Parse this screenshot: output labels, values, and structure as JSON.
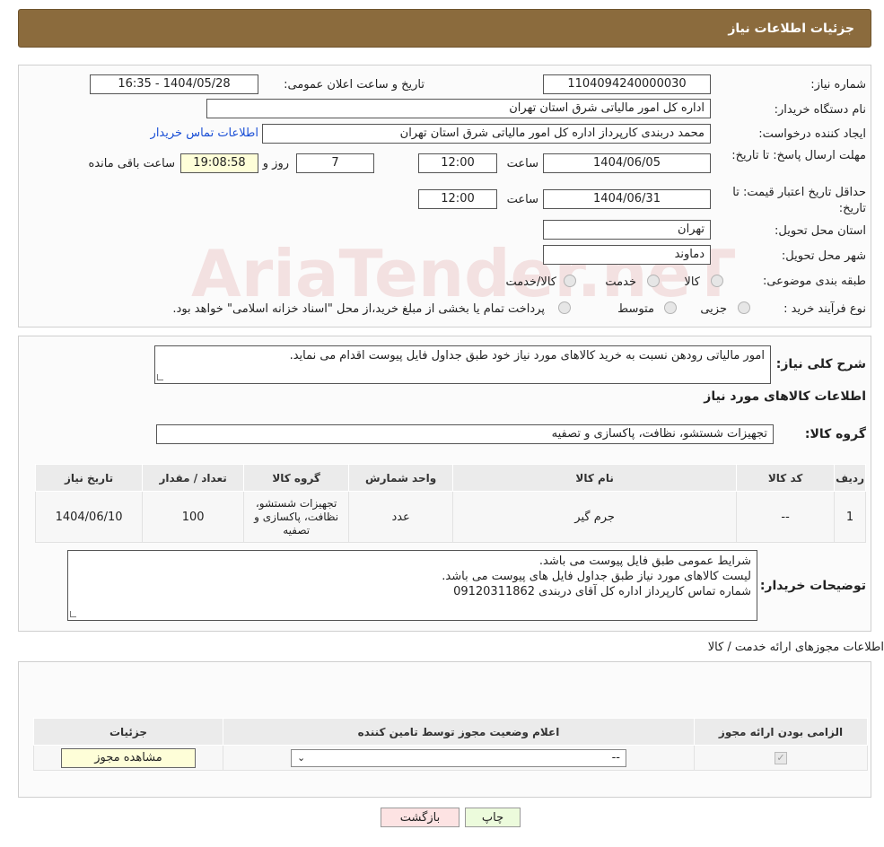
{
  "header": {
    "title": "جزئیات اطلاعات نیاز"
  },
  "watermark": {
    "text": "AriaTender.neT"
  },
  "info": {
    "need_number_label": "شماره نیاز:",
    "need_number": "1104094240000030",
    "announce_label": "تاریخ و ساعت اعلان عمومی:",
    "announce_value": "1404/05/28 - 16:35",
    "buyer_org_label": "نام دستگاه خریدار:",
    "buyer_org": "اداره کل امور مالیاتی شرق استان تهران",
    "creator_label": "ایجاد کننده درخواست:",
    "creator": "محمد دربندی کارپرداز اداره کل امور مالیاتی شرق استان تهران",
    "contact_link": "اطلاعات تماس خریدار",
    "deadline_label": "مهلت ارسال پاسخ: تا تاریخ:",
    "deadline_date": "1404/06/05",
    "time_label": "ساعت",
    "deadline_time": "12:00",
    "days_value": "7",
    "days_label": "روز و",
    "remaining_time": "19:08:58",
    "remaining_label": "ساعت باقی مانده",
    "validity_label": "حداقل تاریخ اعتبار قیمت: تا تاریخ:",
    "validity_date": "1404/06/31",
    "validity_time": "12:00",
    "province_label": "استان محل تحویل:",
    "province": "تهران",
    "city_label": "شهر محل تحویل:",
    "city": "دماوند",
    "category_label": "طبقه بندی موضوعی:",
    "category_options": [
      "کالا",
      "خدمت",
      "کالا/خدمت"
    ],
    "process_label": "نوع فرآیند خرید :",
    "process_options": [
      "جزیی",
      "متوسط"
    ],
    "process_note": "پرداخت تمام یا بخشی از مبلغ خرید،از محل \"اسناد خزانه اسلامی\" خواهد بود."
  },
  "summary": {
    "label": "شرح کلی نیاز:",
    "text": "امور مالیاتی رودهن نسبت به خرید کالاهای مورد نیاز خود طبق جداول فایل پیوست اقدام می نماید.",
    "goods_info_title": "اطلاعات کالاهای مورد نیاز",
    "group_label": "گروه کالا:",
    "group_value": "تجهیزات شستشو، نظافت، پاکسازی و تصفیه"
  },
  "goods_table": {
    "headers": [
      "ردیف",
      "کد کالا",
      "نام کالا",
      "واحد شمارش",
      "گروه کالا",
      "تعداد / مقدار",
      "تاریخ نیاز"
    ],
    "rows": [
      [
        "1",
        "--",
        "جرم گیر",
        "عدد",
        "تجهیزات شستشو، نظافت، پاکسازی و تصفیه",
        "100",
        "1404/06/10"
      ]
    ]
  },
  "buyer_notes": {
    "label": "توضیحات خریدار:",
    "lines": [
      "شرایط عمومی طبق فایل پیوست می باشد.",
      "لیست کالاهای مورد نیاز طبق جداول فایل های پیوست می باشد.",
      "شماره تماس کارپرداز اداره کل  آقای دربندی 09120311862"
    ]
  },
  "licenses": {
    "title": "اطلاعات مجوزهای ارائه خدمت / کالا",
    "headers": [
      "الزامی بودن ارائه مجوز",
      "اعلام وضعیت مجوز توسط تامین کننده",
      "جزئیات"
    ],
    "select_value": "--",
    "view_button": "مشاهده مجوز"
  },
  "footer": {
    "print_button": "چاپ",
    "back_button": "بازگشت"
  }
}
